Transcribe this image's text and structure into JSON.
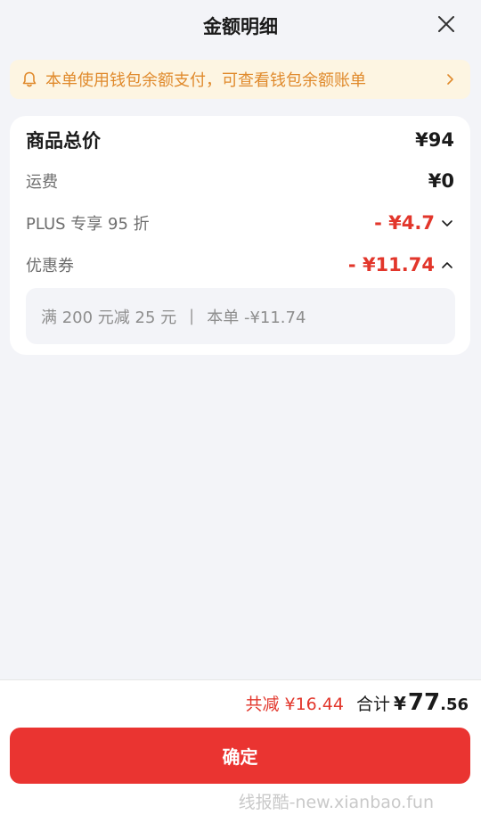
{
  "header": {
    "title": "金额明细",
    "close_icon": "close-icon"
  },
  "notice": {
    "icon": "bell-icon",
    "text": "本单使用钱包余额支付，可查看钱包余额账单",
    "chevron_icon": "chevron-right-icon"
  },
  "breakdown": {
    "rows": [
      {
        "label": "商品总价",
        "value": "¥94"
      },
      {
        "label": "运费",
        "value": "¥0"
      },
      {
        "label": "PLUS 专享 95 折",
        "value": "- ¥4.7",
        "toggle": "chevron-down-icon"
      },
      {
        "label": "优惠券",
        "value": "- ¥11.74",
        "toggle": "chevron-up-icon"
      }
    ],
    "coupon_detail": {
      "condition": "满 200 元减 25 元",
      "separator": "|",
      "applied": "本单 -¥11.74"
    }
  },
  "footer": {
    "saved": "共减 ¥16.44",
    "total_label": "合计",
    "currency": "¥",
    "total_int": "77",
    "total_dec": ".56",
    "confirm_label": "确定",
    "watermark": "线报酷-new.xianbao.fun"
  },
  "colors": {
    "accent_red": "#ea3431",
    "discount_red": "#e2362b",
    "notice_text": "#e08a2c",
    "notice_bg": "#fdf5e2",
    "page_bg": "#f3f4f8"
  }
}
